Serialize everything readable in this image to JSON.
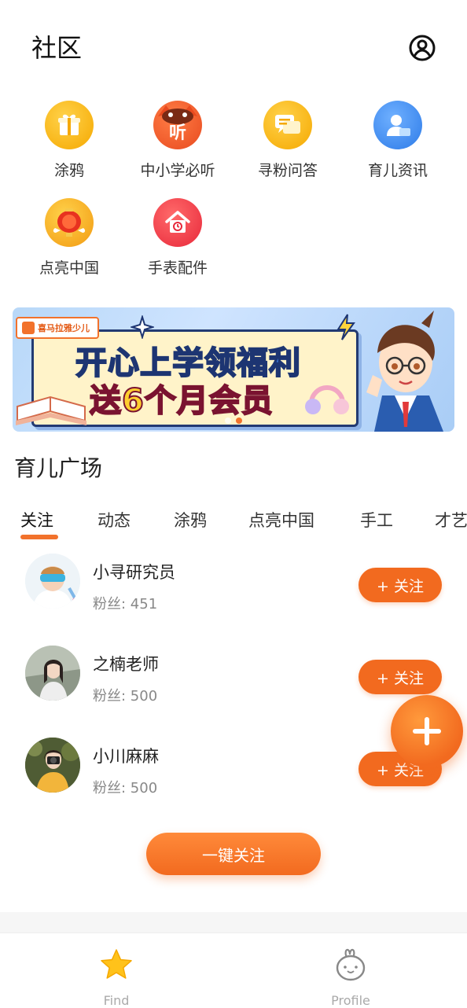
{
  "header": {
    "title": "社区"
  },
  "categories": [
    {
      "label": "涂鸦",
      "icon": "gift-icon",
      "color": "#f7b512"
    },
    {
      "label": "中小学必听",
      "icon": "listen-mascot-icon",
      "color": "#f45b2b"
    },
    {
      "label": "寻粉问答",
      "icon": "chat-icon",
      "color": "#f7b512"
    },
    {
      "label": "育儿资讯",
      "icon": "parenting-news-icon",
      "color": "#3b8cf0"
    },
    {
      "label": "点亮中国",
      "icon": "lantern-icon",
      "color": "#f2552c"
    },
    {
      "label": "手表配件",
      "icon": "house-icon",
      "color": "#f23b4a"
    }
  ],
  "banner": {
    "brand": "喜马拉雅少儿",
    "line1": "开心上学领福利",
    "line2_prefix": "送",
    "line2_num": "6",
    "line2_suffix": "个月会员"
  },
  "section": {
    "title": "育儿广场"
  },
  "tabs": [
    "关注",
    "动态",
    "涂鸦",
    "点亮中国",
    "手工",
    "才艺"
  ],
  "users": [
    {
      "name": "小寻研究员",
      "fans": "粉丝: 451",
      "follow_label": "+ 关注"
    },
    {
      "name": "之楠老师",
      "fans": "粉丝: 500",
      "follow_label": "+ 关注"
    },
    {
      "name": "小川麻麻",
      "fans": "粉丝: 500",
      "follow_label": "+ 关注"
    }
  ],
  "follow_all_label": "一键关注",
  "bottom_nav": [
    {
      "label": "Find",
      "icon": "star-icon"
    },
    {
      "label": "Profile",
      "icon": "bunny-icon"
    }
  ],
  "colors": {
    "accent": "#f26a1f",
    "tab_underline": "#f2722c"
  }
}
